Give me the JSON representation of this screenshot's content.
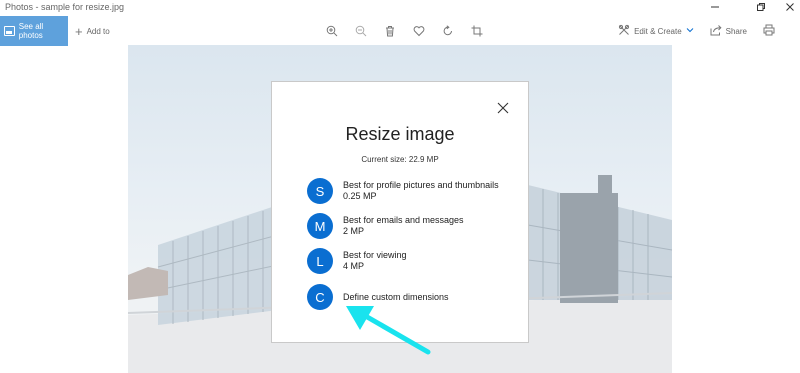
{
  "window": {
    "title": "Photos - sample for resize.jpg"
  },
  "toolbar": {
    "see_all_label": "See all photos",
    "add_to_label": "Add to",
    "edit_create_label": "Edit & Create",
    "share_label": "Share"
  },
  "dialog": {
    "title": "Resize image",
    "current_size": "Current size: 22.9 MP",
    "options": [
      {
        "letter": "S",
        "line1": "Best for profile pictures and thumbnails",
        "line2": "0.25 MP"
      },
      {
        "letter": "M",
        "line1": "Best for emails and messages",
        "line2": "2 MP"
      },
      {
        "letter": "L",
        "line1": "Best for viewing",
        "line2": "4 MP"
      },
      {
        "letter": "C",
        "line1": "Define custom dimensions",
        "line2": ""
      }
    ]
  },
  "colors": {
    "accent": "#0a6ed1",
    "selected_button": "#5ea1dc",
    "annotation_arrow": "#19e3ee"
  },
  "icons": {
    "toolbar": [
      "zoom-in-icon",
      "zoom-out-icon",
      "delete-icon",
      "favorite-icon",
      "rotate-icon",
      "crop-icon"
    ],
    "window": [
      "minimize-icon",
      "restore-icon",
      "close-icon"
    ]
  }
}
